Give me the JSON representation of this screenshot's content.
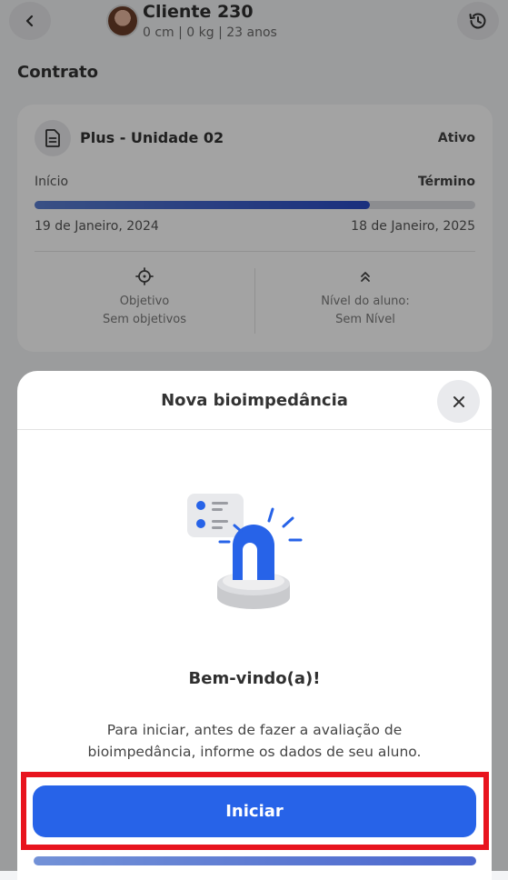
{
  "header": {
    "client_name": "Cliente 230",
    "client_stats": "0 cm |  0 kg |  23 anos"
  },
  "contract": {
    "section_title": "Contrato",
    "plan_name": "Plus - Unidade 02",
    "status": "Ativo",
    "start_label": "Início",
    "end_label": "Término",
    "start_date": "19 de Janeiro, 2024",
    "end_date": "18 de Janeiro, 2025",
    "progress_fraction": 0.76,
    "goal_label": "Objetivo",
    "goal_value": "Sem objetivos",
    "level_label": "Nível do aluno:",
    "level_value": "Sem Nível"
  },
  "modal": {
    "title": "Nova bioimpedância",
    "welcome": "Bem-vindo(a)!",
    "description": "Para iniciar, antes de fazer a avaliação de bioimpedância, informe os dados de seu aluno.",
    "start_button": "Iniciar"
  },
  "colors": {
    "primary": "#2763e8",
    "highlight": "#e8141e"
  },
  "icons": [
    "back-arrow-icon",
    "history-icon",
    "document-icon",
    "target-icon",
    "double-chevron-up-icon",
    "close-icon",
    "alert-siren-icon"
  ]
}
